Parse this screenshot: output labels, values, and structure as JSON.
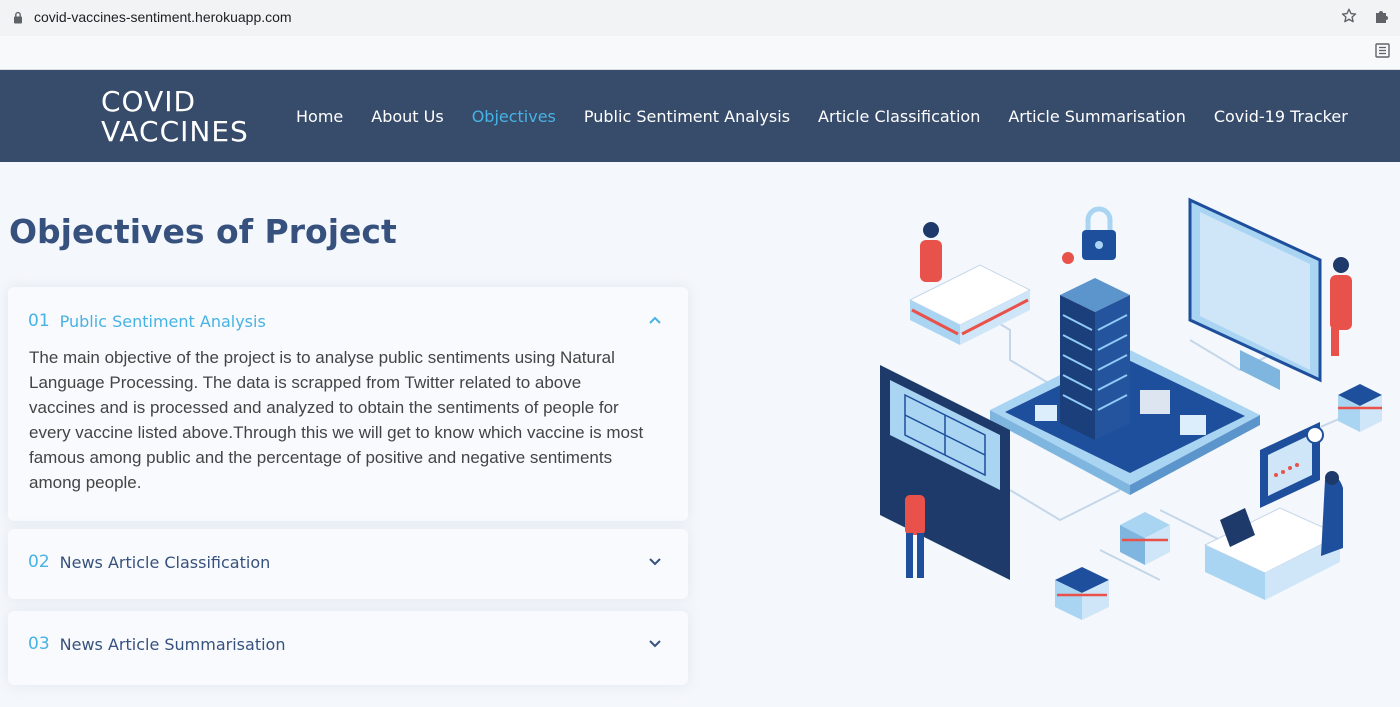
{
  "browser": {
    "url": "covid-vaccines-sentiment.herokuapp.com",
    "icons": [
      "lock-icon",
      "star-icon",
      "puzzle-icon",
      "reader-icon"
    ]
  },
  "nav": {
    "logo_line1": "COVID",
    "logo_line2": "VACCINES",
    "links": [
      {
        "label": "Home",
        "active": false
      },
      {
        "label": "About Us",
        "active": false
      },
      {
        "label": "Objectives",
        "active": true
      },
      {
        "label": "Public Sentiment Analysis",
        "active": false
      },
      {
        "label": "Article Classification",
        "active": false
      },
      {
        "label": "Article Summarisation",
        "active": false
      },
      {
        "label": "Covid-19 Tracker",
        "active": false
      }
    ]
  },
  "main": {
    "title": "Objectives of Project",
    "faq": [
      {
        "num": "01",
        "question": "Public Sentiment Analysis",
        "open": true,
        "answer": "The main objective of the project is to analyse public sentiments using Natural Language Processing. The data is scrapped from Twitter related to above vaccines and is processed and analyzed to obtain the sentiments of people for every vaccine listed above.Through this we will get to know which vaccine is most famous among public and the percentage of positive and negative sentiments among people."
      },
      {
        "num": "02",
        "question": "News Article Classification",
        "open": false
      },
      {
        "num": "03",
        "question": "News Article Summarisation",
        "open": false
      }
    ]
  },
  "colors": {
    "navbar": "#374c6b",
    "accent": "#47b2e4",
    "heading": "#37517e",
    "illustration_blue": "#1e4f9c",
    "illustration_light": "#a9d4f2",
    "illustration_red": "#e8524a"
  }
}
